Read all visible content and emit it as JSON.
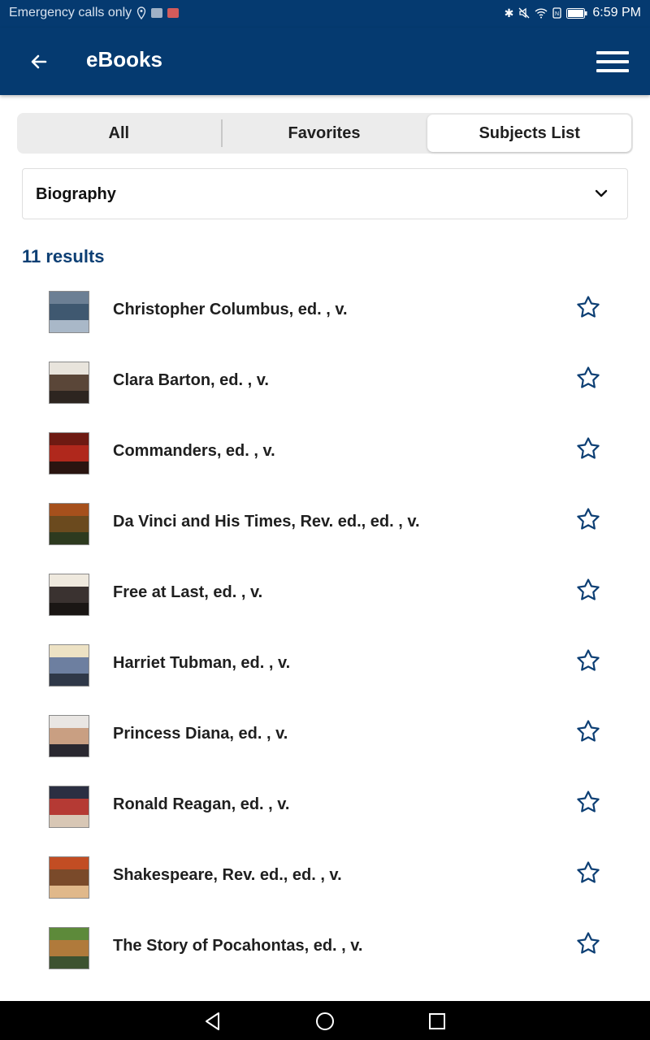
{
  "status_bar": {
    "carrier_text": "Emergency calls only",
    "time": "6:59 PM",
    "left_icons": [
      "location-icon",
      "image-notification-icon",
      "mail-notification-icon"
    ],
    "right_icons": [
      "bluetooth-icon",
      "mute-icon",
      "wifi-icon",
      "nfc-icon",
      "battery-icon"
    ]
  },
  "app_bar": {
    "title": "eBooks",
    "back_icon": "arrow-left-icon",
    "menu_icon": "hamburger-menu-icon",
    "background": "#053a70"
  },
  "tabs": [
    {
      "label": "All",
      "selected": false
    },
    {
      "label": "Favorites",
      "selected": false
    },
    {
      "label": "Subjects List",
      "selected": true
    }
  ],
  "subject_dropdown": {
    "selected": "Biography",
    "icon": "chevron-down-icon"
  },
  "results": {
    "count_label": "11 results",
    "accent": "#0d3f74",
    "items": [
      {
        "title": "Christopher Columbus, ed. , v.",
        "cover_colors": [
          "#6c7f94",
          "#3f5870",
          "#a9b8c8"
        ]
      },
      {
        "title": "Clara Barton, ed. , v.",
        "cover_colors": [
          "#e8e4dc",
          "#5a4638",
          "#2d2520"
        ]
      },
      {
        "title": "Commanders, ed. , v.",
        "cover_colors": [
          "#6e1a12",
          "#b0281c",
          "#2a1410"
        ]
      },
      {
        "title": "Da Vinci and His Times, Rev. ed., ed. , v.",
        "cover_colors": [
          "#a6501c",
          "#6b4a1e",
          "#2d3a1f"
        ]
      },
      {
        "title": "Free at Last, ed. , v.",
        "cover_colors": [
          "#efe9de",
          "#3a3230",
          "#1a1614"
        ]
      },
      {
        "title": "Harriet Tubman, ed. , v.",
        "cover_colors": [
          "#ede2c4",
          "#6d7fa0",
          "#2f3848"
        ]
      },
      {
        "title": "Princess Diana, ed. , v.",
        "cover_colors": [
          "#e9e6e3",
          "#c99f82",
          "#2a2830"
        ]
      },
      {
        "title": "Ronald Reagan, ed. , v.",
        "cover_colors": [
          "#2b2f42",
          "#b53a34",
          "#d8c7b5"
        ]
      },
      {
        "title": "Shakespeare, Rev. ed., ed. , v.",
        "cover_colors": [
          "#c24d23",
          "#7a4a2a",
          "#e0b88a"
        ]
      },
      {
        "title": "The Story of Pocahontas, ed. , v.",
        "cover_colors": [
          "#5d8a3a",
          "#b07a3b",
          "#3d5230"
        ]
      }
    ],
    "favorite_icon": "star-outline-icon",
    "favorite_color": "#0d3f74"
  },
  "system_nav": {
    "icons": [
      "back-triangle-icon",
      "home-circle-icon",
      "recents-square-icon"
    ]
  }
}
